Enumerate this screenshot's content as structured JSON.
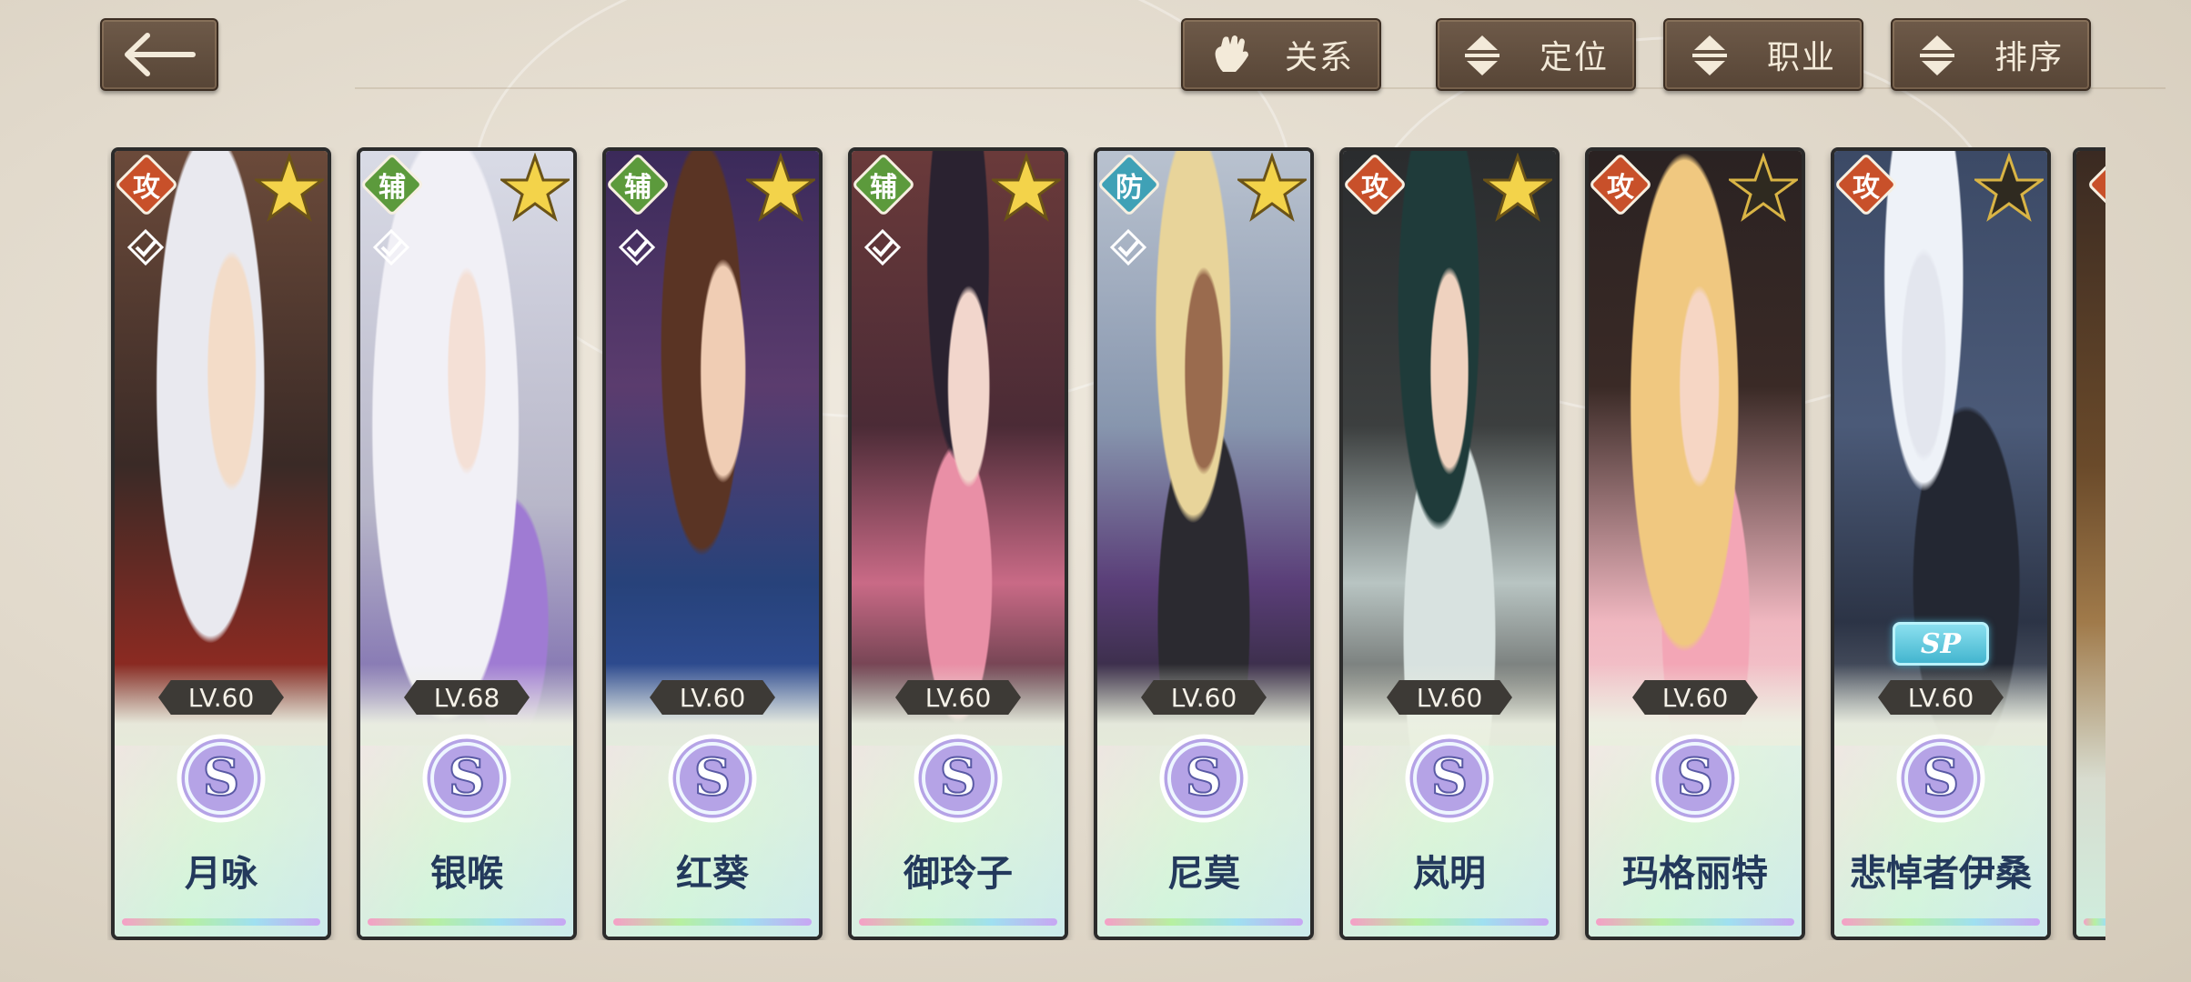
{
  "toolbar": {
    "filters": [
      {
        "label": "关系",
        "icon": "hand-icon"
      },
      {
        "label": "定位",
        "icon": "sort-arrows-icon"
      },
      {
        "label": "职业",
        "icon": "sort-arrows-icon"
      },
      {
        "label": "排序",
        "icon": "sort-arrows-icon"
      }
    ]
  },
  "colors": {
    "role_attack": "#c8502a",
    "role_support": "#5c9a3c",
    "role_defense": "#3fa1b6",
    "name_text": "#23395c"
  },
  "characters": [
    {
      "name": "月咏",
      "role": "攻",
      "level": "LV.60",
      "rank": "S",
      "star": "gold",
      "sp": false
    },
    {
      "name": "银喉",
      "role": "辅",
      "level": "LV.68",
      "rank": "S",
      "star": "gold",
      "sp": false
    },
    {
      "name": "红葵",
      "role": "辅",
      "level": "LV.60",
      "rank": "S",
      "star": "gold",
      "sp": false
    },
    {
      "name": "御玲子",
      "role": "辅",
      "level": "LV.60",
      "rank": "S",
      "star": "gold",
      "sp": false
    },
    {
      "name": "尼莫",
      "role": "防",
      "level": "LV.60",
      "rank": "S",
      "star": "gold",
      "sp": false
    },
    {
      "name": "岚明",
      "role": "攻",
      "level": "LV.60",
      "rank": "S",
      "star": "gold",
      "sp": false
    },
    {
      "name": "玛格丽特",
      "role": "攻",
      "level": "LV.60",
      "rank": "S",
      "star": "dark",
      "sp": false
    },
    {
      "name": "悲悼者伊桑",
      "role": "攻",
      "level": "LV.60",
      "rank": "S",
      "star": "dark",
      "sp": true,
      "sp_label": "SP"
    }
  ]
}
